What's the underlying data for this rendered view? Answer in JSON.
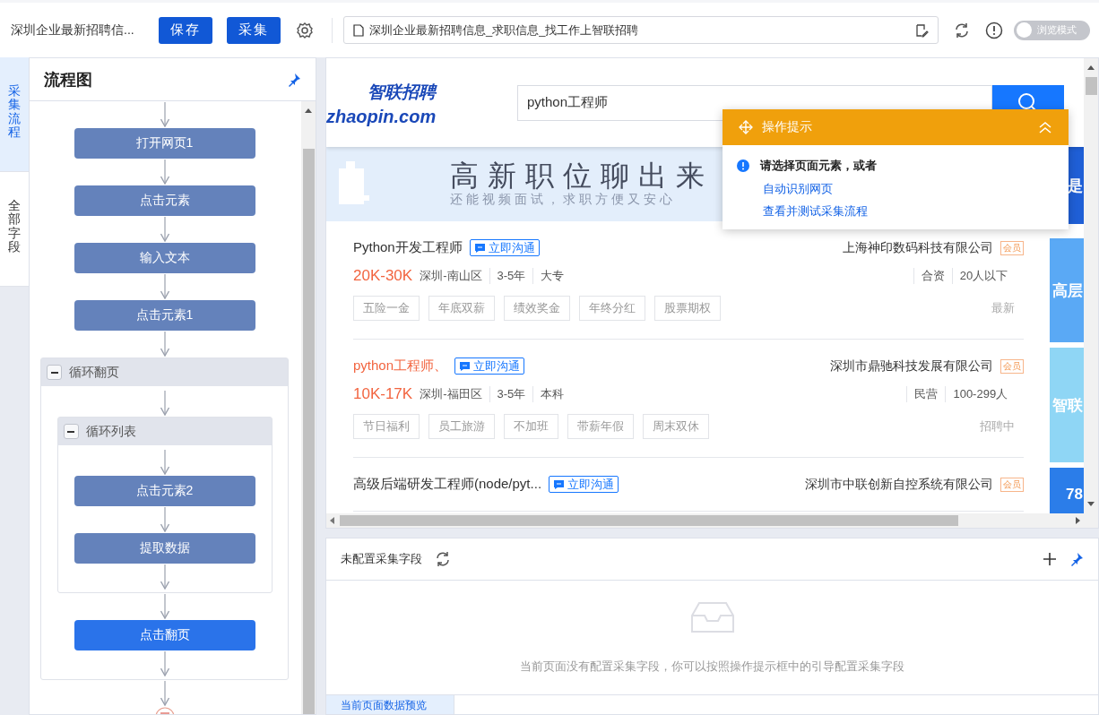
{
  "toolbar": {
    "title": "深圳企业最新招聘信...",
    "buttons": [
      "保存",
      "采集"
    ],
    "url": "深圳企业最新招聘信息_求职信息_找工作上智联招聘",
    "browse_toggle": {
      "label": "浏览模式",
      "on": false
    }
  },
  "side_tabs": [
    {
      "label": "采集流程",
      "selected": true
    },
    {
      "label": "全部字段",
      "selected": false
    }
  ],
  "flow_panel": {
    "title": "流程图",
    "steps": [
      {
        "kind": "step",
        "label": "打开网页1",
        "selected": false
      },
      {
        "kind": "step",
        "label": "点击元素",
        "selected": false
      },
      {
        "kind": "step",
        "label": "输入文本",
        "selected": false
      },
      {
        "kind": "step",
        "label": "点击元素1",
        "selected": false
      },
      {
        "kind": "loop",
        "label": "循环翻页",
        "expanded": true,
        "children": [
          {
            "kind": "loop",
            "label": "循环列表",
            "expanded": true,
            "children": [
              {
                "kind": "step",
                "label": "点击元素2",
                "selected": false
              },
              {
                "kind": "step",
                "label": "提取数据",
                "selected": false
              }
            ]
          },
          {
            "kind": "step",
            "label": "点击翻页",
            "selected": true
          }
        ]
      },
      {
        "kind": "end"
      }
    ]
  },
  "web_page": {
    "logo_cn": "智联招聘",
    "logo_en": "zhaopin.com",
    "search": {
      "value": "python工程师"
    },
    "banner": {
      "headline": "高新职位聊出来",
      "subline": "还能视频面试，求职方便又安心"
    },
    "jobs": [
      {
        "title": "Python开发工程师",
        "highlighted": false,
        "chat": "立即沟通",
        "company": "上海神印数码科技有限公司",
        "badge": "会员",
        "salary": "20K-30K",
        "location": "深圳-南山区",
        "experience": "3-5年",
        "education": "大专",
        "ownership": "合资",
        "size": "20人以下",
        "tags": [
          "五险一金",
          "年底双薪",
          "绩效奖金",
          "年终分红",
          "股票期权"
        ],
        "status": "最新"
      },
      {
        "title": "python工程师、",
        "highlighted": true,
        "chat": "立即沟通",
        "company": "深圳市鼎驰科技发展有限公司",
        "badge": "会员",
        "salary": "10K-17K",
        "location": "深圳-福田区",
        "experience": "3-5年",
        "education": "本科",
        "ownership": "民营",
        "size": "100-299人",
        "tags": [
          "节日福利",
          "员工旅游",
          "不加班",
          "带薪年假",
          "周末双休"
        ],
        "status": "招聘中"
      },
      {
        "title": "高级后端研发工程师(node/pyt...",
        "highlighted": false,
        "chat": "立即沟通",
        "company": "深圳市中联创新自控系统有限公司",
        "badge": "会员"
      }
    ],
    "side_ads": [
      {
        "text": "是",
        "color": "#1f5fd6"
      },
      {
        "text": "高层",
        "color": "#5aa9f5"
      },
      {
        "text": "智联",
        "color": "#8fd6f5"
      },
      {
        "text": "78",
        "color": "#2b7de9"
      }
    ]
  },
  "hint": {
    "title": "操作提示",
    "message": "请选择页面元素，或者",
    "links": [
      "自动识别网页",
      "查看并测试采集流程"
    ]
  },
  "fields_panel": {
    "title": "未配置采集字段",
    "empty_message": "当前页面没有配置采集字段，你可以按照操作提示框中的引导配置采集字段",
    "tabs": [
      {
        "label": "当前页面数据预览",
        "selected": true
      }
    ]
  }
}
